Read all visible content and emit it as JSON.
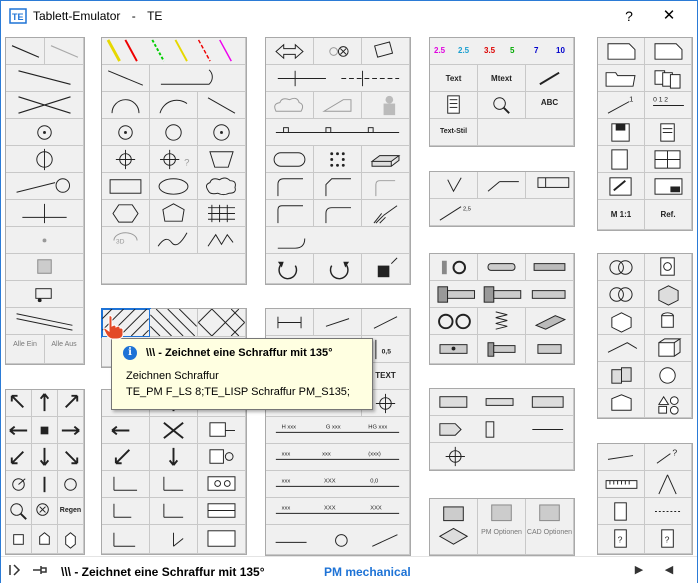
{
  "window": {
    "app_title": "Tablett-Emulator",
    "doc_title": "TE",
    "help_label": "?",
    "close_label": "✕"
  },
  "colors": {
    "accent": "#1e73d6",
    "panel_bg": "#d9d9d9",
    "cell_bg": "#f0f0f0",
    "tooltip_bg": "#ffffe1"
  },
  "tooltip": {
    "title": "\\\\\\ - Zeichnet eine Schraffur mit 135°",
    "line1": "Zeichnen Schraffur",
    "line2": "TE_PM F_LS 8;TE_LISP Schraffur PM_S135;"
  },
  "palette_labels": {
    "alle_ein": "Alle Ein",
    "alle_aus": "Alle Aus",
    "text": "Text",
    "mtext": "Mtext",
    "text_stil": "Text-Stil",
    "abc": "ABC",
    "m11": "M 1:1",
    "ref": "Ref.",
    "regen": "Regen",
    "text_tag": "TEXT",
    "pm_optionen": "PM Optionen",
    "cad_optionen": "CAD Optionen"
  },
  "text_heights": [
    "2.5",
    "2.5",
    "3.5",
    "5",
    "7",
    "10"
  ],
  "statusbar": {
    "message": "\\\\\\ - Zeichnet eine Schraffur mit 135°",
    "profile": "PM mechanical",
    "right_arrow": "▶",
    "left_arrow": "◀"
  }
}
